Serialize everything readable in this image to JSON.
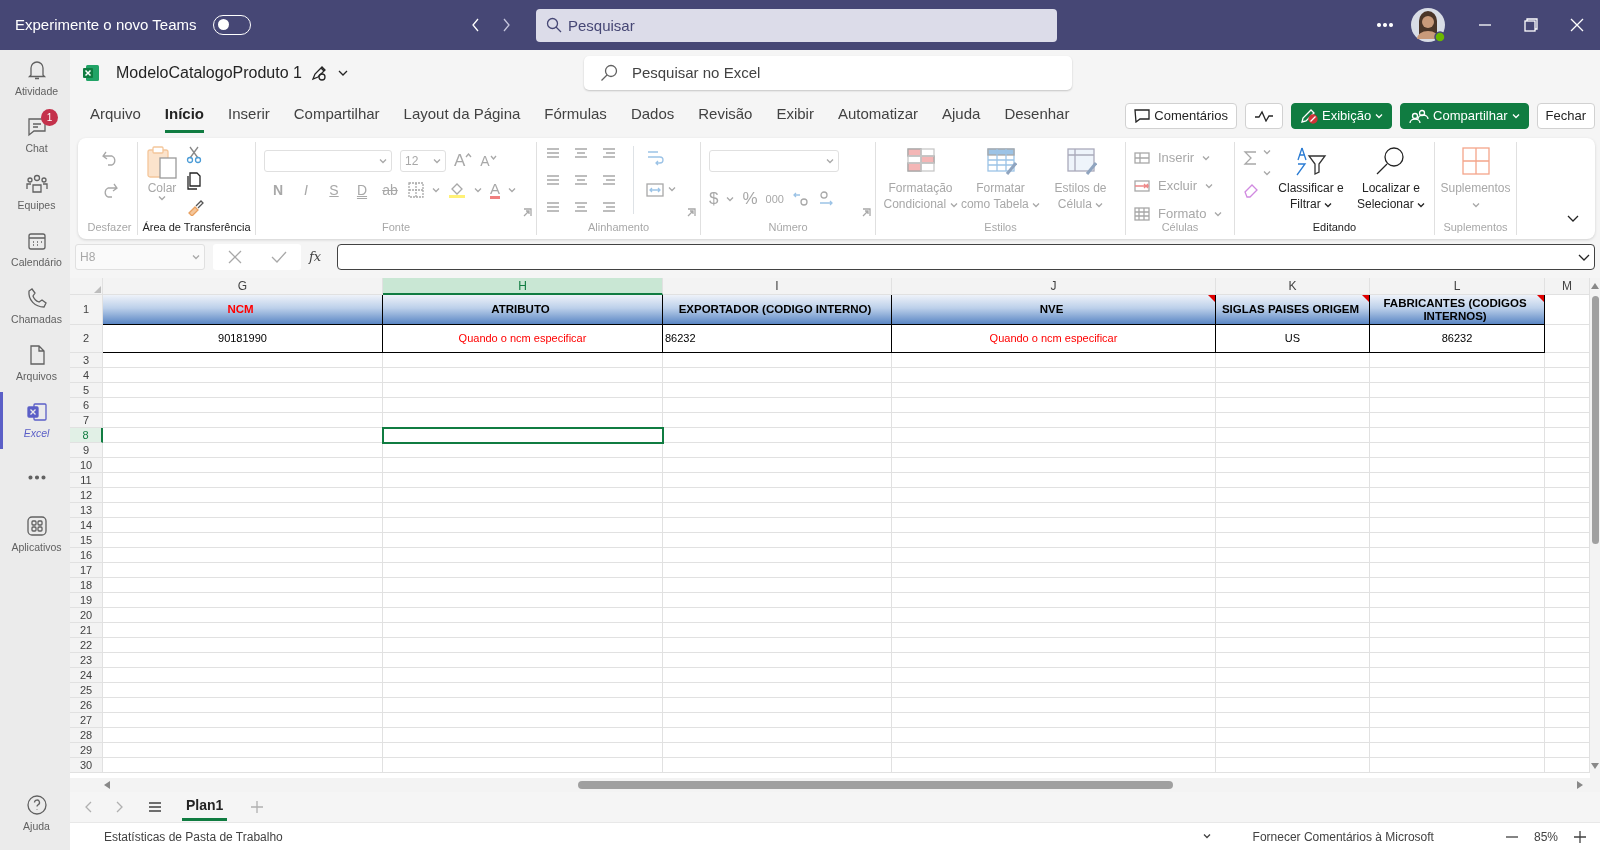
{
  "teams_bar": {
    "banner": "Experimente o novo Teams",
    "toggle_on": false,
    "search_placeholder": "Pesquisar"
  },
  "rail": [
    {
      "kind": "bell",
      "label": "Atividade",
      "selected": false
    },
    {
      "kind": "chat",
      "label": "Chat",
      "selected": false,
      "badge": "1"
    },
    {
      "kind": "team",
      "label": "Equipes",
      "selected": false
    },
    {
      "kind": "calendar",
      "label": "Calendário",
      "selected": false
    },
    {
      "kind": "phone",
      "label": "Chamadas",
      "selected": false
    },
    {
      "kind": "file",
      "label": "Arquivos",
      "selected": false
    },
    {
      "kind": "excel",
      "label": "Excel",
      "selected": true
    },
    {
      "kind": "more",
      "selected": false
    },
    {
      "kind": "apps",
      "label": "Aplicativos",
      "selected": false
    }
  ],
  "rail_help": {
    "label": "Ajuda"
  },
  "file": {
    "name": "ModeloCatalogoProduto 1"
  },
  "excel_search": {
    "placeholder": "Pesquisar no Excel"
  },
  "tabs": [
    {
      "label": "Arquivo",
      "selected": false
    },
    {
      "label": "Início",
      "selected": true
    },
    {
      "label": "Inserir",
      "selected": false
    },
    {
      "label": "Compartilhar",
      "selected": false
    },
    {
      "label": "Layout da Página",
      "selected": false
    },
    {
      "label": "Fórmulas",
      "selected": false
    },
    {
      "label": "Dados",
      "selected": false
    },
    {
      "label": "Revisão",
      "selected": false
    },
    {
      "label": "Exibir",
      "selected": false
    },
    {
      "label": "Automatizar",
      "selected": false
    },
    {
      "label": "Ajuda",
      "selected": false
    },
    {
      "label": "Desenhar",
      "selected": false
    }
  ],
  "actions": [
    {
      "kind": "comments",
      "label": "Comentários"
    },
    {
      "kind": "activity"
    },
    {
      "kind": "view",
      "label": "Exibição"
    },
    {
      "kind": "share",
      "label": "Compartilhar"
    },
    {
      "kind": "close",
      "label": "Fechar"
    }
  ],
  "ribbon": {
    "groups": [
      {
        "kind": "undo",
        "label": "Desfazer",
        "disabled": true
      },
      {
        "kind": "clipboard",
        "label": "Área de Transferência",
        "disabled": false,
        "buttons": [
          {
            "label": "Colar",
            "disabled": true
          }
        ]
      },
      {
        "kind": "font",
        "label": "Fonte",
        "disabled": true,
        "font_size": "12",
        "grow_shrink": [
          "A",
          "A"
        ],
        "styles": [
          "N",
          "I",
          "S",
          "D",
          "ab"
        ],
        "font_color": "A"
      },
      {
        "kind": "align",
        "label": "Alinhamento",
        "disabled": true
      },
      {
        "kind": "number",
        "label": "Número",
        "disabled": true,
        "symbols": [
          "$",
          "%",
          "000"
        ]
      },
      {
        "kind": "large",
        "label": "Estilos",
        "disabled": true,
        "buttons": [
          {
            "label": "Formatação Condicional",
            "disabled": true
          },
          {
            "label": "Formatar como Tabela",
            "disabled": true
          },
          {
            "label": "Estilos de Célula",
            "disabled": true
          }
        ]
      },
      {
        "kind": "small",
        "label": "Células",
        "disabled": true,
        "buttons": [
          {
            "label": "Inserir",
            "disabled": true
          },
          {
            "label": "Excluir",
            "disabled": true
          },
          {
            "label": "Formato",
            "disabled": true
          }
        ]
      },
      {
        "kind": "editing",
        "label": "Editando",
        "disabled": false,
        "buttons": [
          {
            "label": "Classificar e Filtrar",
            "disabled": false
          },
          {
            "label": "Localizar e Selecionar",
            "disabled": false
          }
        ]
      },
      {
        "kind": "large",
        "label": "Suplementos",
        "disabled": true,
        "buttons": [
          {
            "label": "Suplementos",
            "disabled": true
          }
        ]
      }
    ]
  },
  "formula_bar": {
    "name_box": "H8",
    "fx": "fx"
  },
  "sheet": {
    "columns": [
      {
        "letter": "G",
        "selected": false
      },
      {
        "letter": "H",
        "selected": true
      },
      {
        "letter": "I",
        "selected": false
      },
      {
        "letter": "J",
        "selected": false
      },
      {
        "letter": "K",
        "selected": false
      },
      {
        "letter": "L",
        "selected": false
      },
      {
        "letter": "M",
        "selected": false
      }
    ],
    "rows": [
      {
        "number": "1",
        "selected": false,
        "kind": "header",
        "cells": [
          {
            "text": "NCM",
            "color": "#ff0000",
            "comment": false
          },
          {
            "text": "ATRIBUTO",
            "color": "#000000",
            "comment": false
          },
          {
            "text": "EXPORTADOR (CODIGO INTERNO)",
            "color": "#000000",
            "comment": false
          },
          {
            "text": "NVE",
            "color": "#000000",
            "comment": true
          },
          {
            "text": "SIGLAS PAISES ORIGEM",
            "color": "#000000",
            "comment": true
          },
          {
            "text": "FABRICANTES (CODIGOS INTERNOS)",
            "color": "#000000",
            "comment": true
          }
        ]
      },
      {
        "number": "2",
        "selected": false,
        "kind": "data",
        "cells": [
          {
            "text": "90181990",
            "red_text": false,
            "left_aligned": false
          },
          {
            "text": "Quando o ncm especificar",
            "red_text": true,
            "left_aligned": false
          },
          {
            "text": "86232",
            "red_text": false,
            "left_aligned": true
          },
          {
            "text": "Quando o ncm especificar",
            "red_text": true,
            "left_aligned": false
          },
          {
            "text": "US",
            "red_text": false,
            "left_aligned": false
          },
          {
            "text": "86232",
            "red_text": false,
            "left_aligned": false
          }
        ]
      },
      {
        "number": "3",
        "selected": false
      },
      {
        "number": "4",
        "selected": false
      },
      {
        "number": "5",
        "selected": false
      },
      {
        "number": "6",
        "selected": false
      },
      {
        "number": "7",
        "selected": false
      },
      {
        "number": "8",
        "selected": true
      },
      {
        "number": "9",
        "selected": false
      },
      {
        "number": "10",
        "selected": false
      },
      {
        "number": "11",
        "selected": false
      },
      {
        "number": "12",
        "selected": false
      },
      {
        "number": "13",
        "selected": false
      },
      {
        "number": "14",
        "selected": false
      },
      {
        "number": "15",
        "selected": false
      },
      {
        "number": "16",
        "selected": false
      },
      {
        "number": "17",
        "selected": false
      },
      {
        "number": "18",
        "selected": false
      },
      {
        "number": "19",
        "selected": false
      },
      {
        "number": "20",
        "selected": false
      },
      {
        "number": "21",
        "selected": false
      },
      {
        "number": "22",
        "selected": false
      },
      {
        "number": "23",
        "selected": false
      },
      {
        "number": "24",
        "selected": false
      },
      {
        "number": "25",
        "selected": false
      },
      {
        "number": "26",
        "selected": false
      },
      {
        "number": "27",
        "selected": false
      },
      {
        "number": "28",
        "selected": false
      },
      {
        "number": "29",
        "selected": false
      },
      {
        "number": "30",
        "selected": false
      }
    ]
  },
  "sheet_tabs": [
    {
      "label": "Plan1",
      "selected": true
    }
  ],
  "status_bar": {
    "left": "Estatísticas de Pasta de Trabalho",
    "feedback": "Fornecer Comentários à Microsoft",
    "zoom": "85%"
  }
}
